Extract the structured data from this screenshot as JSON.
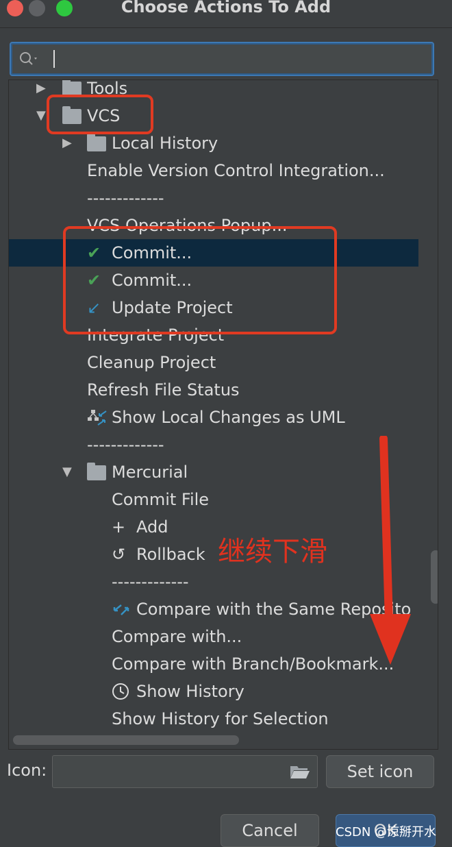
{
  "window": {
    "title": "Choose Actions To Add"
  },
  "search": {
    "value": ""
  },
  "tree": {
    "rows": [
      {
        "label": "Tools",
        "type": "folder",
        "expanded": false
      },
      {
        "label": "VCS",
        "type": "folder",
        "expanded": true
      },
      {
        "label": "Local History",
        "type": "folder",
        "expanded": false
      },
      {
        "label": "Enable Version Control Integration...",
        "type": "action"
      },
      {
        "label": "-------------",
        "type": "separator"
      },
      {
        "label": "VCS Operations Popup...",
        "type": "action"
      },
      {
        "label": "Commit...",
        "type": "action",
        "icon": "check-icon",
        "selected": true
      },
      {
        "label": "Commit...",
        "type": "action",
        "icon": "check-icon"
      },
      {
        "label": "Update Project",
        "type": "action",
        "icon": "update-arrow-icon"
      },
      {
        "label": "Integrate Project",
        "type": "action"
      },
      {
        "label": "Cleanup Project",
        "type": "action"
      },
      {
        "label": "Refresh File Status",
        "type": "action"
      },
      {
        "label": "Show Local Changes as UML",
        "type": "action",
        "icon": "uml-diagram-icon"
      },
      {
        "label": "-------------",
        "type": "separator"
      },
      {
        "label": "Mercurial",
        "type": "folder",
        "expanded": true
      },
      {
        "label": "Commit File",
        "type": "action"
      },
      {
        "label": "Add",
        "type": "action",
        "icon": "plus-icon"
      },
      {
        "label": "Rollback",
        "type": "action",
        "icon": "rollback-icon"
      },
      {
        "label": "-------------",
        "type": "separator"
      },
      {
        "label": "Compare with the Same Reposito",
        "type": "action",
        "icon": "compare-icon"
      },
      {
        "label": "Compare with...",
        "type": "action"
      },
      {
        "label": "Compare with Branch/Bookmark...",
        "type": "action"
      },
      {
        "label": "Show History",
        "type": "action",
        "icon": "clock-icon"
      },
      {
        "label": "Show History for Selection",
        "type": "action"
      }
    ]
  },
  "annotation": {
    "text": "继续下滑"
  },
  "icon_field": {
    "label": "Icon:",
    "value": ""
  },
  "buttons": {
    "set_icon": "Set icon",
    "cancel": "Cancel",
    "ok": "OK"
  },
  "watermark": "CSDN @涼掰开水",
  "colors": {
    "selection": "#0d293e",
    "annotation_red": "#e03a22",
    "check_green": "#4aa257",
    "update_blue": "#3592c4",
    "ok_button": "#365880"
  }
}
